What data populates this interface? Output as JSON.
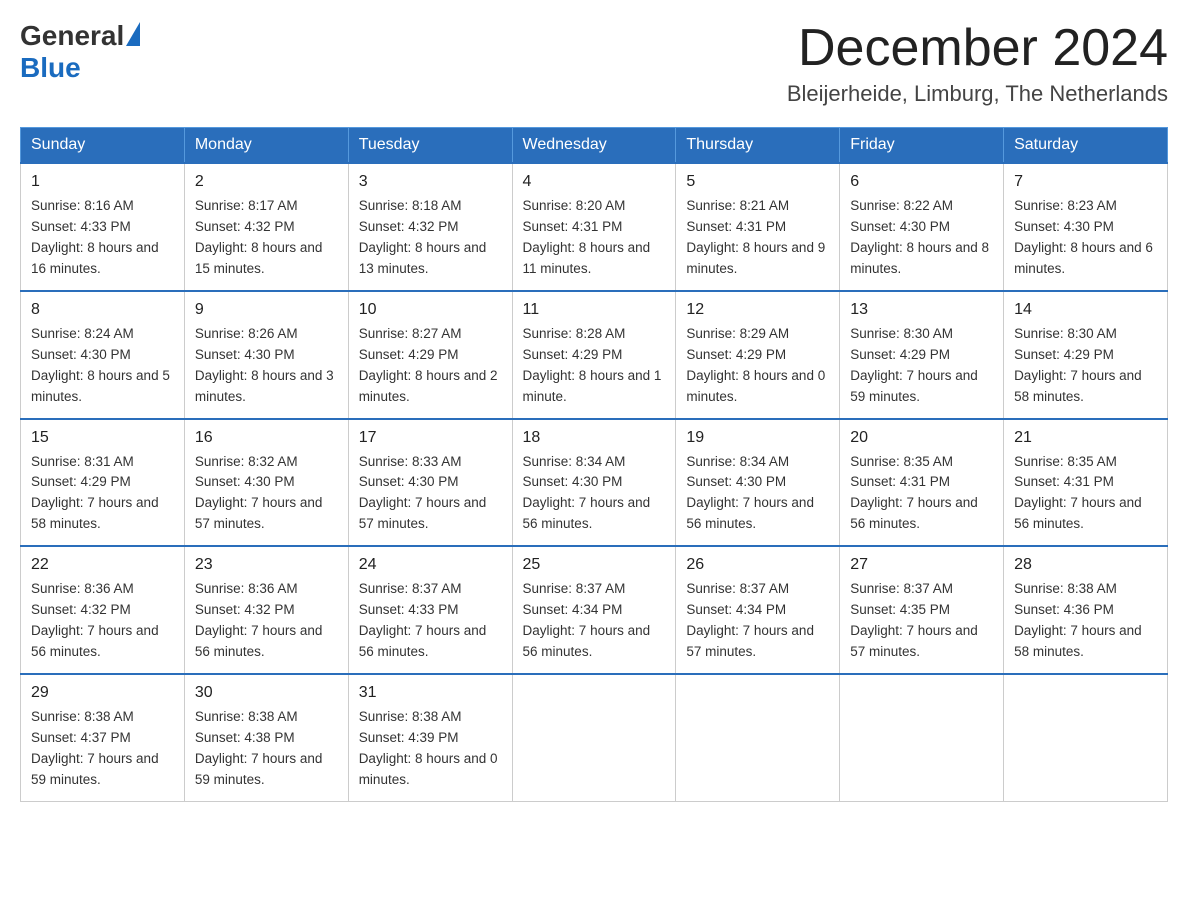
{
  "header": {
    "logo_general": "General",
    "logo_blue": "Blue",
    "month_year": "December 2024",
    "location": "Bleijerheide, Limburg, The Netherlands"
  },
  "weekdays": [
    "Sunday",
    "Monday",
    "Tuesday",
    "Wednesday",
    "Thursday",
    "Friday",
    "Saturday"
  ],
  "weeks": [
    [
      {
        "day": "1",
        "sunrise": "8:16 AM",
        "sunset": "4:33 PM",
        "daylight": "8 hours and 16 minutes."
      },
      {
        "day": "2",
        "sunrise": "8:17 AM",
        "sunset": "4:32 PM",
        "daylight": "8 hours and 15 minutes."
      },
      {
        "day": "3",
        "sunrise": "8:18 AM",
        "sunset": "4:32 PM",
        "daylight": "8 hours and 13 minutes."
      },
      {
        "day": "4",
        "sunrise": "8:20 AM",
        "sunset": "4:31 PM",
        "daylight": "8 hours and 11 minutes."
      },
      {
        "day": "5",
        "sunrise": "8:21 AM",
        "sunset": "4:31 PM",
        "daylight": "8 hours and 9 minutes."
      },
      {
        "day": "6",
        "sunrise": "8:22 AM",
        "sunset": "4:30 PM",
        "daylight": "8 hours and 8 minutes."
      },
      {
        "day": "7",
        "sunrise": "8:23 AM",
        "sunset": "4:30 PM",
        "daylight": "8 hours and 6 minutes."
      }
    ],
    [
      {
        "day": "8",
        "sunrise": "8:24 AM",
        "sunset": "4:30 PM",
        "daylight": "8 hours and 5 minutes."
      },
      {
        "day": "9",
        "sunrise": "8:26 AM",
        "sunset": "4:30 PM",
        "daylight": "8 hours and 3 minutes."
      },
      {
        "day": "10",
        "sunrise": "8:27 AM",
        "sunset": "4:29 PM",
        "daylight": "8 hours and 2 minutes."
      },
      {
        "day": "11",
        "sunrise": "8:28 AM",
        "sunset": "4:29 PM",
        "daylight": "8 hours and 1 minute."
      },
      {
        "day": "12",
        "sunrise": "8:29 AM",
        "sunset": "4:29 PM",
        "daylight": "8 hours and 0 minutes."
      },
      {
        "day": "13",
        "sunrise": "8:30 AM",
        "sunset": "4:29 PM",
        "daylight": "7 hours and 59 minutes."
      },
      {
        "day": "14",
        "sunrise": "8:30 AM",
        "sunset": "4:29 PM",
        "daylight": "7 hours and 58 minutes."
      }
    ],
    [
      {
        "day": "15",
        "sunrise": "8:31 AM",
        "sunset": "4:29 PM",
        "daylight": "7 hours and 58 minutes."
      },
      {
        "day": "16",
        "sunrise": "8:32 AM",
        "sunset": "4:30 PM",
        "daylight": "7 hours and 57 minutes."
      },
      {
        "day": "17",
        "sunrise": "8:33 AM",
        "sunset": "4:30 PM",
        "daylight": "7 hours and 57 minutes."
      },
      {
        "day": "18",
        "sunrise": "8:34 AM",
        "sunset": "4:30 PM",
        "daylight": "7 hours and 56 minutes."
      },
      {
        "day": "19",
        "sunrise": "8:34 AM",
        "sunset": "4:30 PM",
        "daylight": "7 hours and 56 minutes."
      },
      {
        "day": "20",
        "sunrise": "8:35 AM",
        "sunset": "4:31 PM",
        "daylight": "7 hours and 56 minutes."
      },
      {
        "day": "21",
        "sunrise": "8:35 AM",
        "sunset": "4:31 PM",
        "daylight": "7 hours and 56 minutes."
      }
    ],
    [
      {
        "day": "22",
        "sunrise": "8:36 AM",
        "sunset": "4:32 PM",
        "daylight": "7 hours and 56 minutes."
      },
      {
        "day": "23",
        "sunrise": "8:36 AM",
        "sunset": "4:32 PM",
        "daylight": "7 hours and 56 minutes."
      },
      {
        "day": "24",
        "sunrise": "8:37 AM",
        "sunset": "4:33 PM",
        "daylight": "7 hours and 56 minutes."
      },
      {
        "day": "25",
        "sunrise": "8:37 AM",
        "sunset": "4:34 PM",
        "daylight": "7 hours and 56 minutes."
      },
      {
        "day": "26",
        "sunrise": "8:37 AM",
        "sunset": "4:34 PM",
        "daylight": "7 hours and 57 minutes."
      },
      {
        "day": "27",
        "sunrise": "8:37 AM",
        "sunset": "4:35 PM",
        "daylight": "7 hours and 57 minutes."
      },
      {
        "day": "28",
        "sunrise": "8:38 AM",
        "sunset": "4:36 PM",
        "daylight": "7 hours and 58 minutes."
      }
    ],
    [
      {
        "day": "29",
        "sunrise": "8:38 AM",
        "sunset": "4:37 PM",
        "daylight": "7 hours and 59 minutes."
      },
      {
        "day": "30",
        "sunrise": "8:38 AM",
        "sunset": "4:38 PM",
        "daylight": "7 hours and 59 minutes."
      },
      {
        "day": "31",
        "sunrise": "8:38 AM",
        "sunset": "4:39 PM",
        "daylight": "8 hours and 0 minutes."
      },
      null,
      null,
      null,
      null
    ]
  ]
}
